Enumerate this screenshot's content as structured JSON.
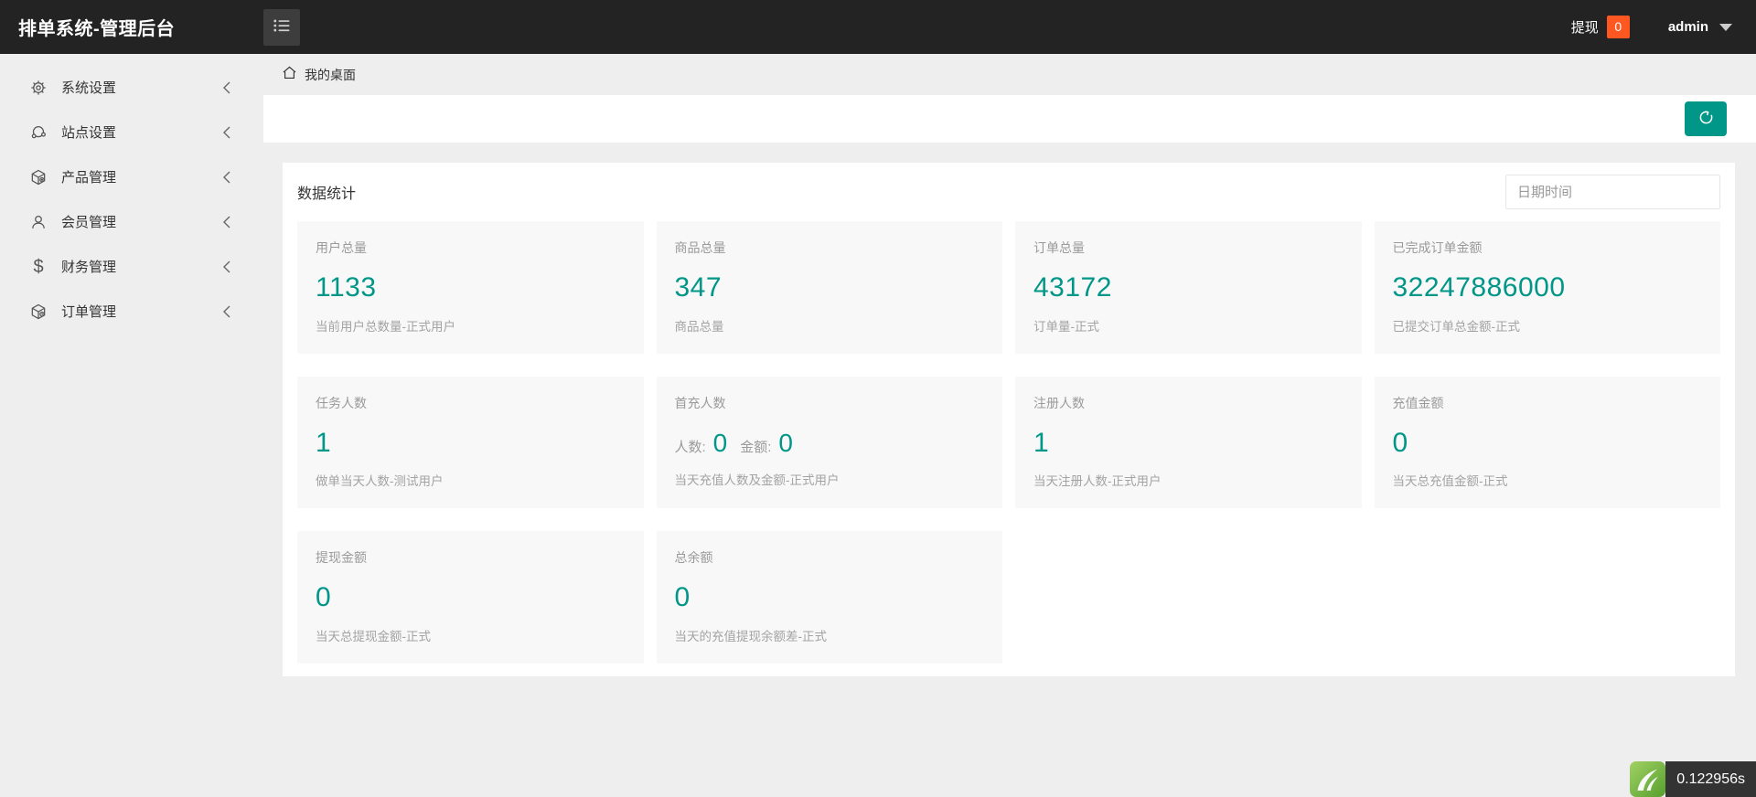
{
  "header": {
    "title": "排单系统-管理后台",
    "hamburger_icon": "menu-list-icon",
    "withdraw_label": "提现",
    "withdraw_badge": "0",
    "username": "admin"
  },
  "sidebar": {
    "items": [
      {
        "icon": "gear-icon",
        "label": "系统设置"
      },
      {
        "icon": "site-network-icon",
        "label": "站点设置"
      },
      {
        "icon": "product-cube-icon",
        "label": "产品管理"
      },
      {
        "icon": "user-icon",
        "label": "会员管理"
      },
      {
        "icon": "dollar-icon",
        "label": "财务管理"
      },
      {
        "icon": "order-cube-icon",
        "label": "订单管理"
      }
    ]
  },
  "breadcrumb": {
    "home_icon": "home-icon",
    "label": "我的桌面"
  },
  "toolbar": {
    "refresh_icon": "refresh-icon"
  },
  "panel": {
    "title": "数据统计",
    "date_placeholder": "日期时间"
  },
  "cards": [
    {
      "title": "用户总量",
      "value": "1133",
      "desc": "当前用户总数量-正式用户"
    },
    {
      "title": "商品总量",
      "value": "347",
      "desc": "商品总量"
    },
    {
      "title": "订单总量",
      "value": "43172",
      "desc": "订单量-正式"
    },
    {
      "title": "已完成订单金额",
      "value": "32247886000",
      "desc": "已提交订单总金额-正式"
    },
    {
      "title": "任务人数",
      "value": "1",
      "desc": "做单当天人数-测试用户"
    },
    {
      "title": "首充人数",
      "pairs": [
        {
          "label": "人数:",
          "value": "0"
        },
        {
          "label": "金额:",
          "value": "0"
        }
      ],
      "desc": "当天充值人数及金额-正式用户"
    },
    {
      "title": "注册人数",
      "value": "1",
      "desc": "当天注册人数-正式用户"
    },
    {
      "title": "充值金额",
      "value": "0",
      "desc": "当天总充值金额-正式"
    },
    {
      "title": "提现金额",
      "value": "0",
      "desc": "当天总提现金额-正式"
    },
    {
      "title": "总余额",
      "value": "0",
      "desc": "当天的充值提现余额差-正式"
    }
  ],
  "statusbar": {
    "brand_icon": "thinkphp-logo-icon",
    "render_time": "0.122956s"
  },
  "colors": {
    "accent_teal": "#009688",
    "withdraw_badge": "#ff5722",
    "header_bg": "#232323",
    "sidebar_bg": "#eeeeee",
    "card_bg": "#f8f8f8"
  }
}
